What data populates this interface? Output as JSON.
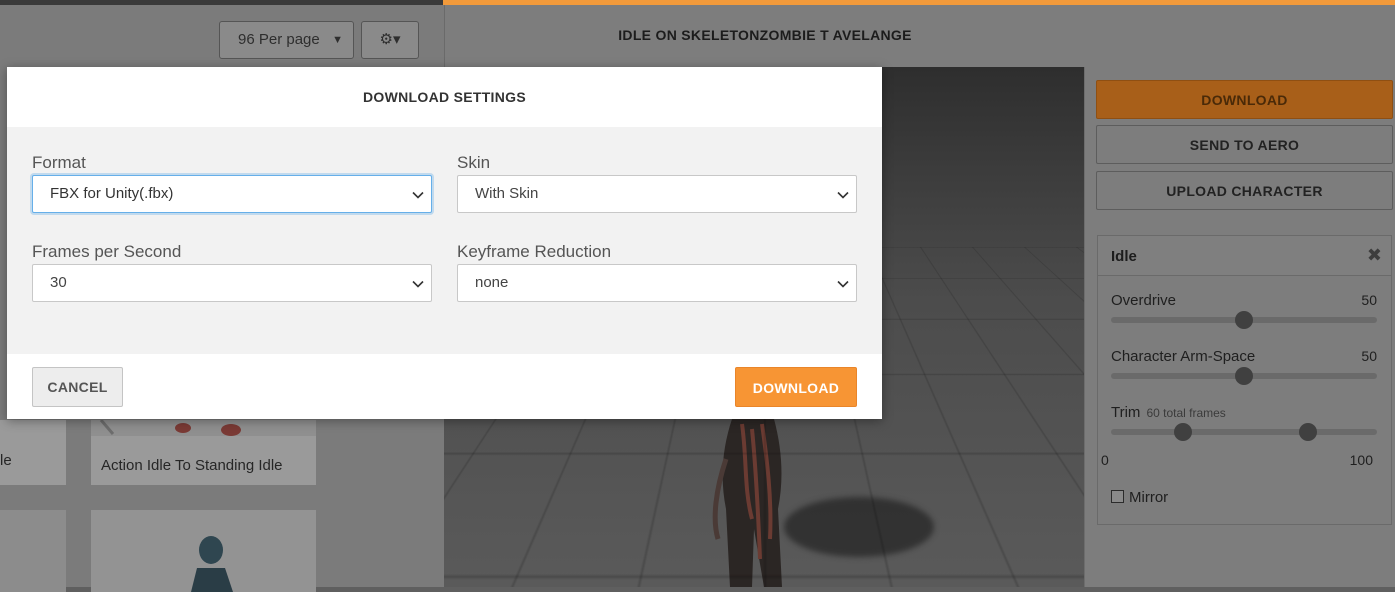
{
  "library": {
    "per_page": "96 Per page",
    "cards": [
      {
        "label": "le"
      },
      {
        "label": "Action Idle To Standing Idle"
      }
    ]
  },
  "viewer": {
    "title": "IDLE ON SKELETONZOMBIE T AVELANGE"
  },
  "sidebar": {
    "download_label": "DOWNLOAD",
    "send_to_aero_label": "SEND TO AERO",
    "upload_character_label": "UPLOAD CHARACTER",
    "animation": {
      "name": "Idle",
      "overdrive": {
        "label": "Overdrive",
        "value": "50",
        "level": 50
      },
      "arm_space": {
        "label": "Character Arm-Space",
        "value": "50",
        "level": 50
      },
      "trim": {
        "label": "Trim",
        "sub": "60 total frames",
        "min": "0",
        "max": "100",
        "start": 27,
        "end": 74
      },
      "mirror_label": "Mirror",
      "mirror_checked": false
    },
    "accent_color": "#f79534"
  },
  "modal": {
    "title": "DOWNLOAD SETTINGS",
    "format": {
      "label": "Format",
      "value": "FBX for Unity(.fbx)"
    },
    "skin": {
      "label": "Skin",
      "value": "With Skin"
    },
    "fps": {
      "label": "Frames per Second",
      "value": "30"
    },
    "keyframe": {
      "label": "Keyframe Reduction",
      "value": "none"
    },
    "cancel_label": "CANCEL",
    "download_label": "DOWNLOAD"
  }
}
